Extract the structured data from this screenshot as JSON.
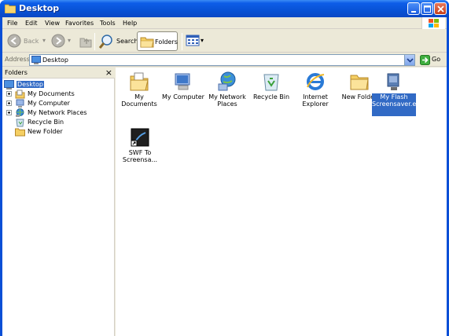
{
  "window": {
    "title": "Desktop"
  },
  "menu": [
    "File",
    "Edit",
    "View",
    "Favorites",
    "Tools",
    "Help"
  ],
  "toolbar": {
    "back_label": "Back",
    "search_label": "Search",
    "folders_label": "Folders"
  },
  "address": {
    "label": "Address",
    "value": "Desktop",
    "go_label": "Go"
  },
  "tree": {
    "title": "Folders",
    "items": [
      {
        "label": "Desktop",
        "icon": "desktop-icon"
      },
      {
        "label": "My Documents",
        "icon": "my-documents-icon"
      },
      {
        "label": "My Computer",
        "icon": "my-computer-icon"
      },
      {
        "label": "My Network Places",
        "icon": "network-places-icon"
      },
      {
        "label": "Recycle Bin",
        "icon": "recycle-bin-icon"
      },
      {
        "label": "New Folder",
        "icon": "folder-icon"
      }
    ]
  },
  "content": {
    "items": [
      {
        "label": "My Documents",
        "icon": "my-documents-icon"
      },
      {
        "label": "My Computer",
        "icon": "my-computer-icon"
      },
      {
        "label": "My Network Places",
        "icon": "network-places-icon"
      },
      {
        "label": "Recycle Bin",
        "icon": "recycle-bin-icon"
      },
      {
        "label": "Internet Explorer",
        "icon": "internet-explorer-icon"
      },
      {
        "label": "New Folder",
        "icon": "folder-icon"
      },
      {
        "label": "My Flash Screensaver.exe",
        "icon": "screensaver-exe-icon",
        "selected": true
      },
      {
        "label": "SWF To Screensa...",
        "icon": "swf-shortcut-icon"
      }
    ]
  },
  "colors": {
    "titlebar": "#0a47c4",
    "selection": "#316ac5",
    "chrome": "#ece9d8"
  }
}
